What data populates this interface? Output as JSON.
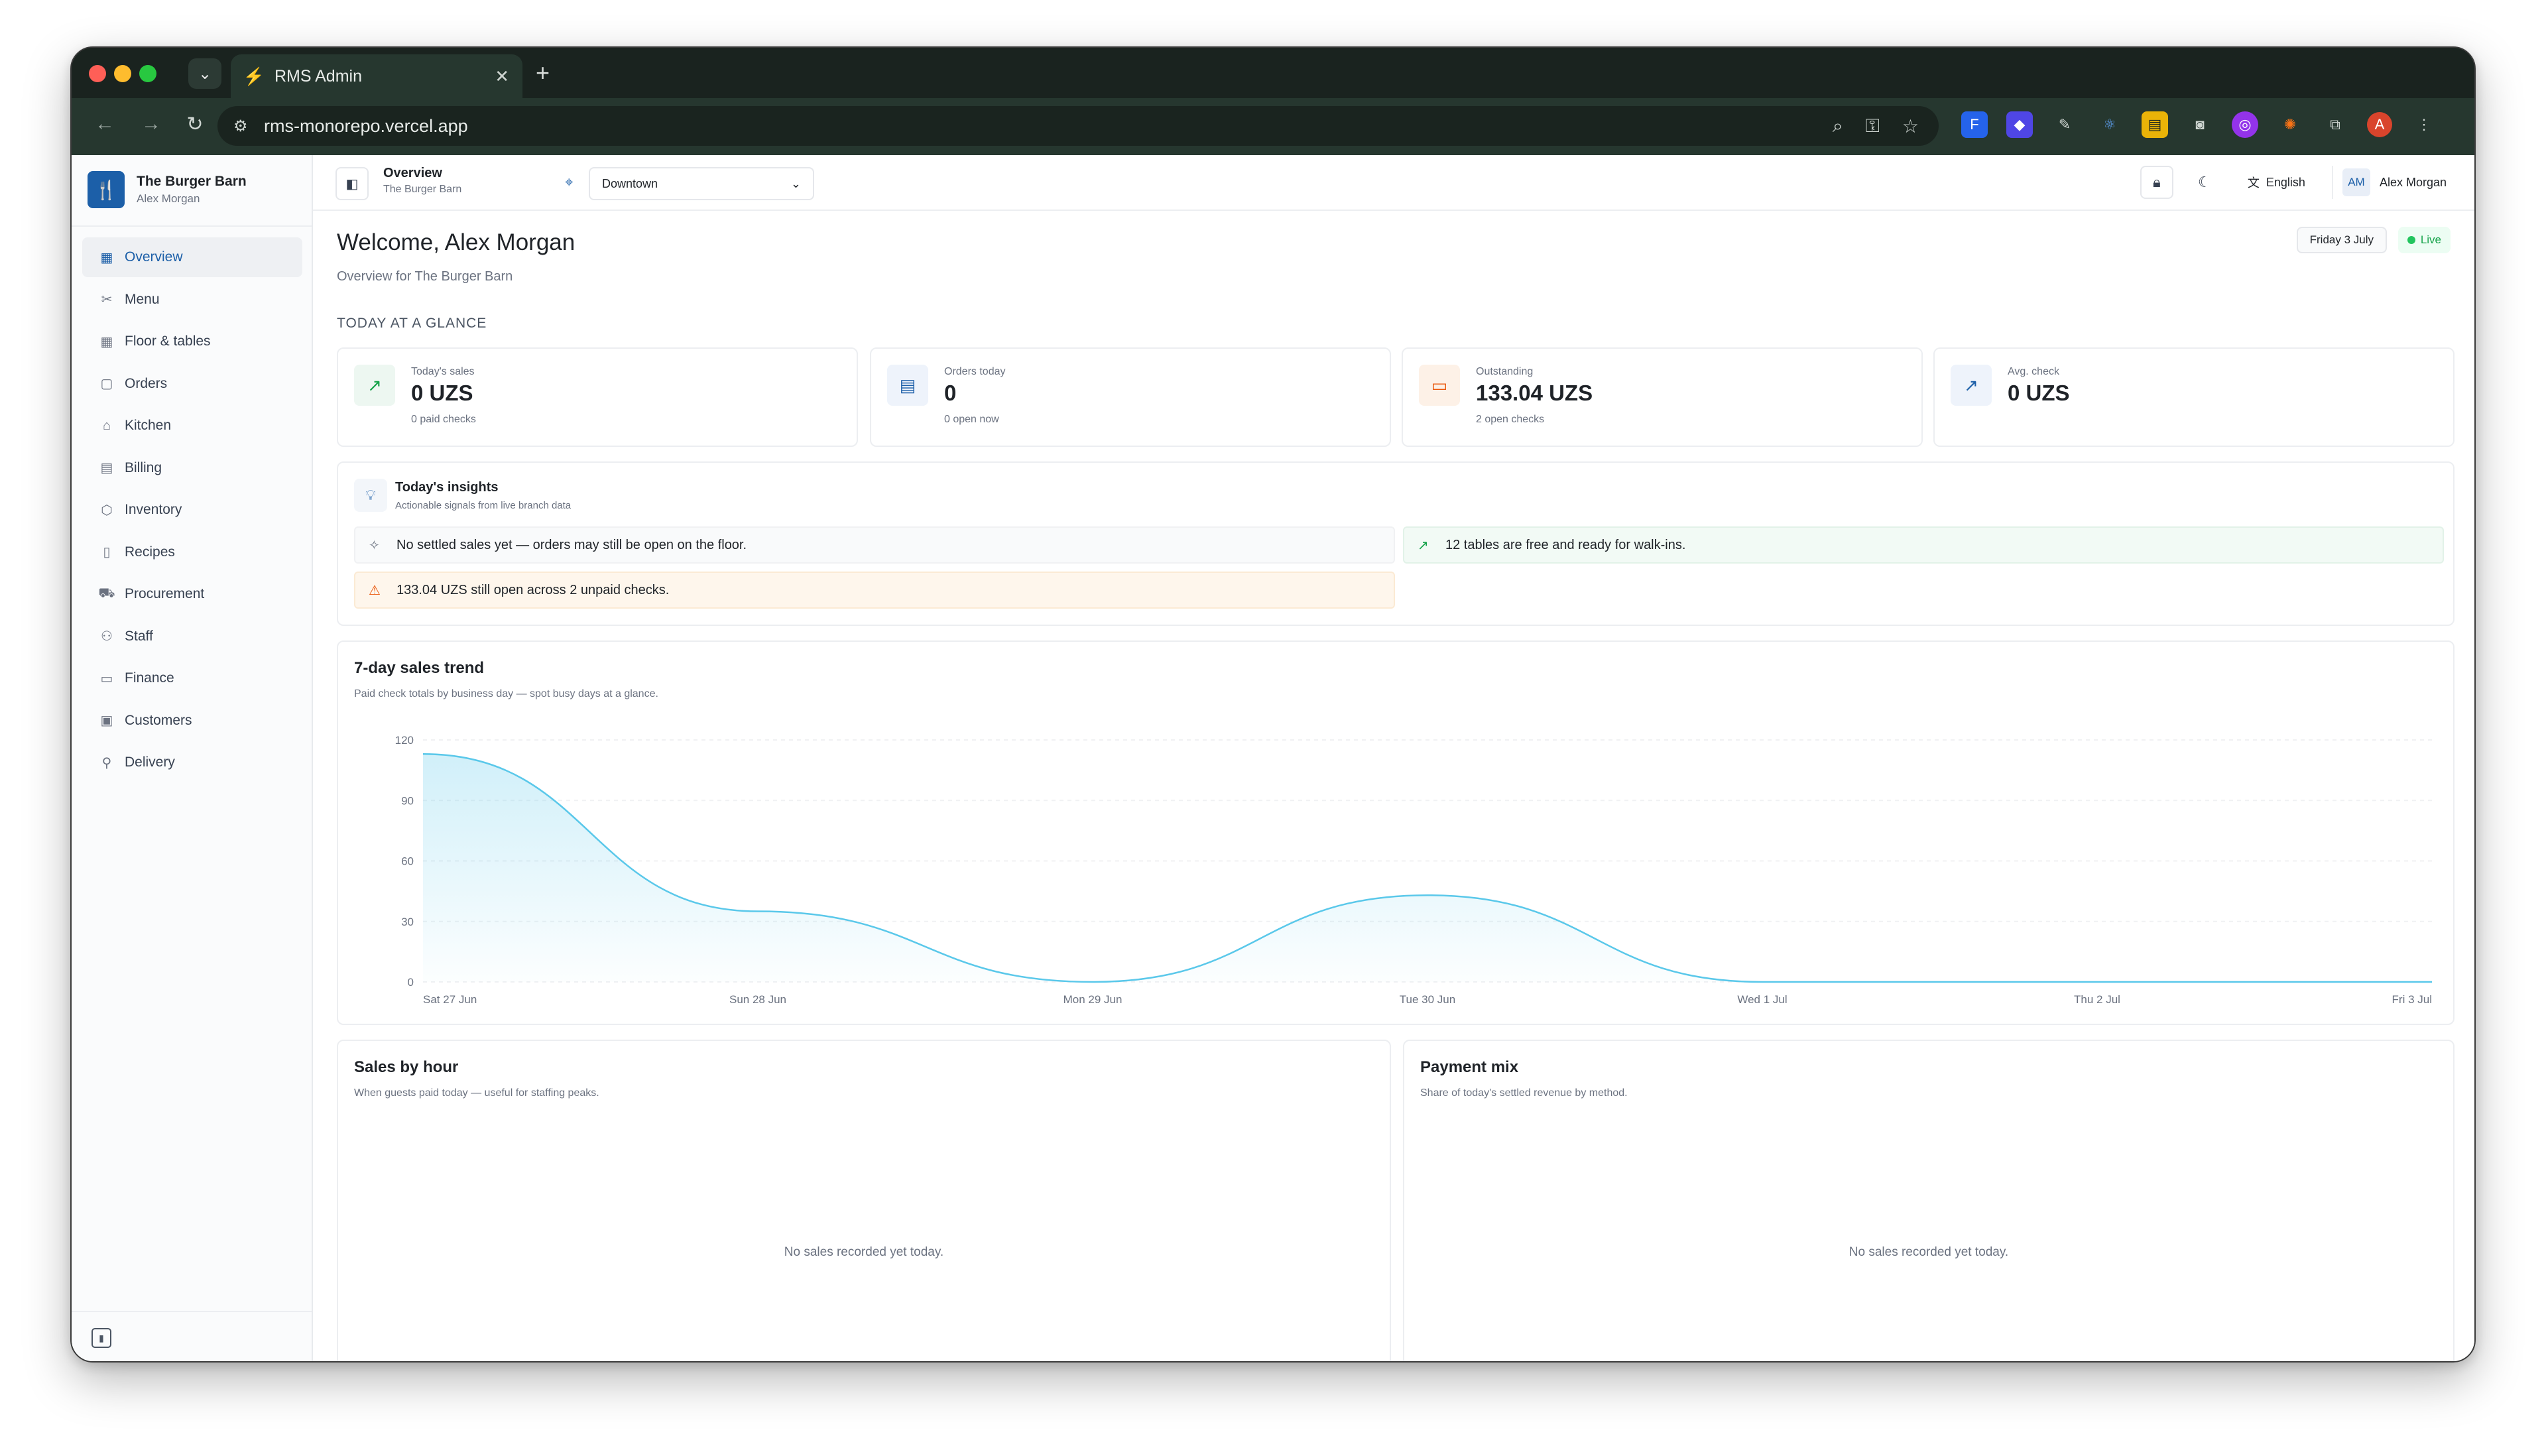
{
  "browser": {
    "tab_title": "RMS Admin",
    "url": "rms-monorepo.vercel.app"
  },
  "sidebar": {
    "brand_name": "The Burger Barn",
    "brand_user": "Alex Morgan",
    "items": [
      {
        "label": "Overview",
        "icon": "grid-icon"
      },
      {
        "label": "Menu",
        "icon": "utensils-icon"
      },
      {
        "label": "Floor & tables",
        "icon": "tables-icon"
      },
      {
        "label": "Orders",
        "icon": "clipboard-icon"
      },
      {
        "label": "Kitchen",
        "icon": "chef-hat-icon"
      },
      {
        "label": "Billing",
        "icon": "receipt-icon"
      },
      {
        "label": "Inventory",
        "icon": "package-icon"
      },
      {
        "label": "Recipes",
        "icon": "book-icon"
      },
      {
        "label": "Procurement",
        "icon": "truck-icon"
      },
      {
        "label": "Staff",
        "icon": "users-icon"
      },
      {
        "label": "Finance",
        "icon": "wallet-icon"
      },
      {
        "label": "Customers",
        "icon": "contact-icon"
      },
      {
        "label": "Delivery",
        "icon": "bike-icon"
      }
    ]
  },
  "header": {
    "title": "Overview",
    "subtitle": "The Burger Barn",
    "location": "Downtown",
    "language": "English",
    "user_initials": "AM",
    "user_name": "Alex Morgan"
  },
  "main": {
    "welcome": "Welcome, Alex Morgan",
    "welcome_sub": "Overview for The Burger Barn",
    "date": "Friday 3 July",
    "live": "Live",
    "glance_label": "TODAY AT A GLANCE",
    "kpis": [
      {
        "label": "Today's sales",
        "value": "0 UZS",
        "sub": "0 paid checks",
        "icon": "trend-up-icon",
        "color": "#16a34a",
        "bg": "#edf7f1"
      },
      {
        "label": "Orders today",
        "value": "0",
        "sub": "0 open now",
        "icon": "receipt-icon",
        "color": "#1c5fa8",
        "bg": "#eef3fb"
      },
      {
        "label": "Outstanding",
        "value": "133.04 UZS",
        "sub": "2 open checks",
        "icon": "wallet-icon",
        "color": "#ea580c",
        "bg": "#fdf1e7"
      },
      {
        "label": "Avg. check",
        "value": "0 UZS",
        "sub": "",
        "icon": "trend-up-icon",
        "color": "#1c5fa8",
        "bg": "#eef3fb"
      }
    ],
    "insights": {
      "title": "Today's insights",
      "subtitle": "Actionable signals from live branch data",
      "items": [
        {
          "text": "No settled sales yet — orders may still be open on the floor.",
          "icon": "sparkle-icon",
          "tone": "neutral"
        },
        {
          "text": "12 tables are free and ready for walk-ins.",
          "icon": "trend-up-icon",
          "tone": "success"
        },
        {
          "text": "133.04 UZS still open across 2 unpaid checks.",
          "icon": "warning-icon",
          "tone": "warning"
        }
      ]
    },
    "sales_trend": {
      "title": "7-day sales trend",
      "subtitle": "Paid check totals by business day — spot busy days at a glance."
    },
    "sales_by_hour": {
      "title": "Sales by hour",
      "subtitle": "When guests paid today — useful for staffing peaks.",
      "empty": "No sales recorded yet today."
    },
    "payment_mix": {
      "title": "Payment mix",
      "subtitle": "Share of today's settled revenue by method.",
      "empty": "No sales recorded yet today."
    }
  },
  "chart_data": {
    "type": "area",
    "title": "7-day sales trend",
    "categories": [
      "Sat 27 Jun",
      "Sun 28 Jun",
      "Mon 29 Jun",
      "Tue 30 Jun",
      "Wed 1 Jul",
      "Thu 2 Jul",
      "Fri 3 Jul"
    ],
    "values": [
      113,
      35,
      0,
      43,
      0,
      0,
      0
    ],
    "yticks": [
      0,
      30,
      60,
      90,
      120
    ],
    "ylim": [
      0,
      120
    ],
    "color": "#5ac8ea",
    "grid": true
  }
}
